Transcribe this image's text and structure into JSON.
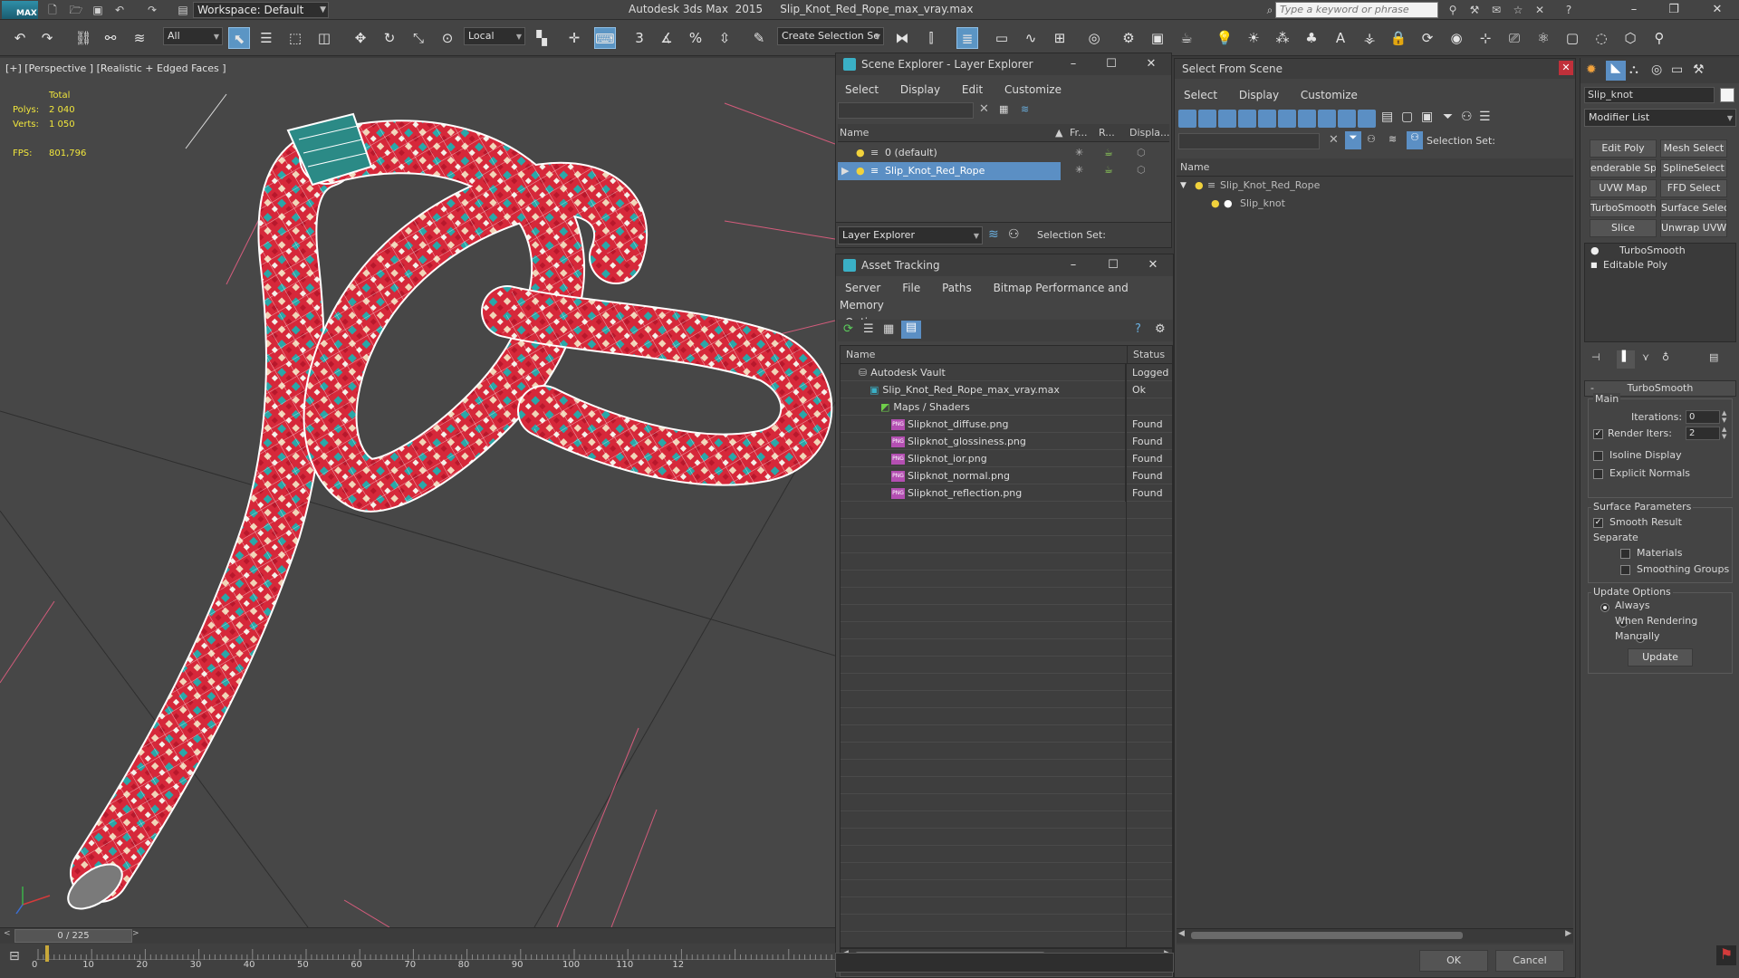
{
  "app": {
    "logo": "MAX",
    "title": "Autodesk 3ds Max  2015     Slip_Knot_Red_Rope_max_vray.max",
    "workspace": "Workspace: Default",
    "search_placeholder": "Type a keyword or phrase"
  },
  "toolbar": {
    "selection_filter": "All",
    "ref_coord": "Local",
    "named_selection": "Create Selection Se",
    "snap_label": "3",
    "percent_snap": "%"
  },
  "viewport": {
    "label": "[+] [Perspective ] [Realistic + Edged Faces ]",
    "stats": {
      "total_label": "Total",
      "polys_label": "Polys:",
      "polys_value": "2 040",
      "verts_label": "Verts:",
      "verts_value": "1 050",
      "fps_label": "FPS:",
      "fps_value": "801,796"
    }
  },
  "scene_explorer": {
    "title": "Scene Explorer - Layer Explorer",
    "menu": [
      "Select",
      "Display",
      "Edit",
      "Customize"
    ],
    "columns": [
      "Name",
      "Fr...",
      "R...",
      "Displa..."
    ],
    "rows": [
      {
        "name": "0 (default)",
        "selected": false
      },
      {
        "name": "Slip_Knot_Red_Rope",
        "selected": true
      }
    ],
    "footer_dropdown": "Layer Explorer",
    "footer_selection_set": "Selection Set:"
  },
  "asset_tracking": {
    "title": "Asset Tracking",
    "menu": [
      "Server",
      "File",
      "Paths",
      "Bitmap Performance and Memory",
      "Options"
    ],
    "columns": [
      "Name",
      "Status"
    ],
    "rows": [
      {
        "name": "Autodesk Vault",
        "status": "Logged (",
        "indent": 0,
        "kind": "vault"
      },
      {
        "name": "Slip_Knot_Red_Rope_max_vray.max",
        "status": "Ok",
        "indent": 1,
        "kind": "max"
      },
      {
        "name": "Maps / Shaders",
        "status": "",
        "indent": 2,
        "kind": "maps"
      },
      {
        "name": "Slipknot_diffuse.png",
        "status": "Found",
        "indent": 3,
        "kind": "png"
      },
      {
        "name": "Slipknot_glossiness.png",
        "status": "Found",
        "indent": 3,
        "kind": "png"
      },
      {
        "name": "Slipknot_ior.png",
        "status": "Found",
        "indent": 3,
        "kind": "png"
      },
      {
        "name": "Slipknot_normal.png",
        "status": "Found",
        "indent": 3,
        "kind": "png"
      },
      {
        "name": "Slipknot_reflection.png",
        "status": "Found",
        "indent": 3,
        "kind": "png"
      }
    ],
    "png_badge": "PNG"
  },
  "select_from_scene": {
    "title": "Select From Scene",
    "menu": [
      "Select",
      "Display",
      "Customize"
    ],
    "selection_set": "Selection Set:",
    "column": "Name",
    "tree": [
      {
        "name": "Slip_Knot_Red_Rope",
        "level": 0
      },
      {
        "name": "Slip_knot",
        "level": 1
      }
    ],
    "ok": "OK",
    "cancel": "Cancel"
  },
  "command_panel": {
    "object_name": "Slip_knot",
    "modifier_list": "Modifier List",
    "buttons": [
      "Edit Poly",
      "Mesh Select",
      "enderable Splin",
      "SplineSelect",
      "UVW Map",
      "FFD Select",
      "TurboSmooth",
      "Surface Select",
      "Slice",
      "Unwrap UVW"
    ],
    "stack": [
      "TurboSmooth",
      "Editable Poly"
    ],
    "rollout_title": "TurboSmooth",
    "main_label": "Main",
    "iterations_label": "Iterations:",
    "iterations_value": "0",
    "render_iters_label": "Render Iters:",
    "render_iters_value": "2",
    "isoline_display": "Isoline Display",
    "explicit_normals": "Explicit Normals",
    "surface_params": "Surface Parameters",
    "smooth_result": "Smooth Result",
    "separate": "Separate",
    "materials": "Materials",
    "smoothing_groups": "Smoothing Groups",
    "update_options": "Update Options",
    "always": "Always",
    "when_rendering": "When Rendering",
    "manually": "Manually",
    "update": "Update"
  },
  "timeline": {
    "frame": "0 / 225",
    "ticks": [
      "0",
      "10",
      "20",
      "30",
      "40",
      "50",
      "60",
      "70",
      "80",
      "90",
      "100",
      "110",
      "12"
    ]
  },
  "colors": {
    "rope_red": "#d8283a",
    "rope_teal": "#2aa7a8",
    "selection_blue": "#5b8fc4",
    "stats_yellow": "#f1e63c"
  }
}
